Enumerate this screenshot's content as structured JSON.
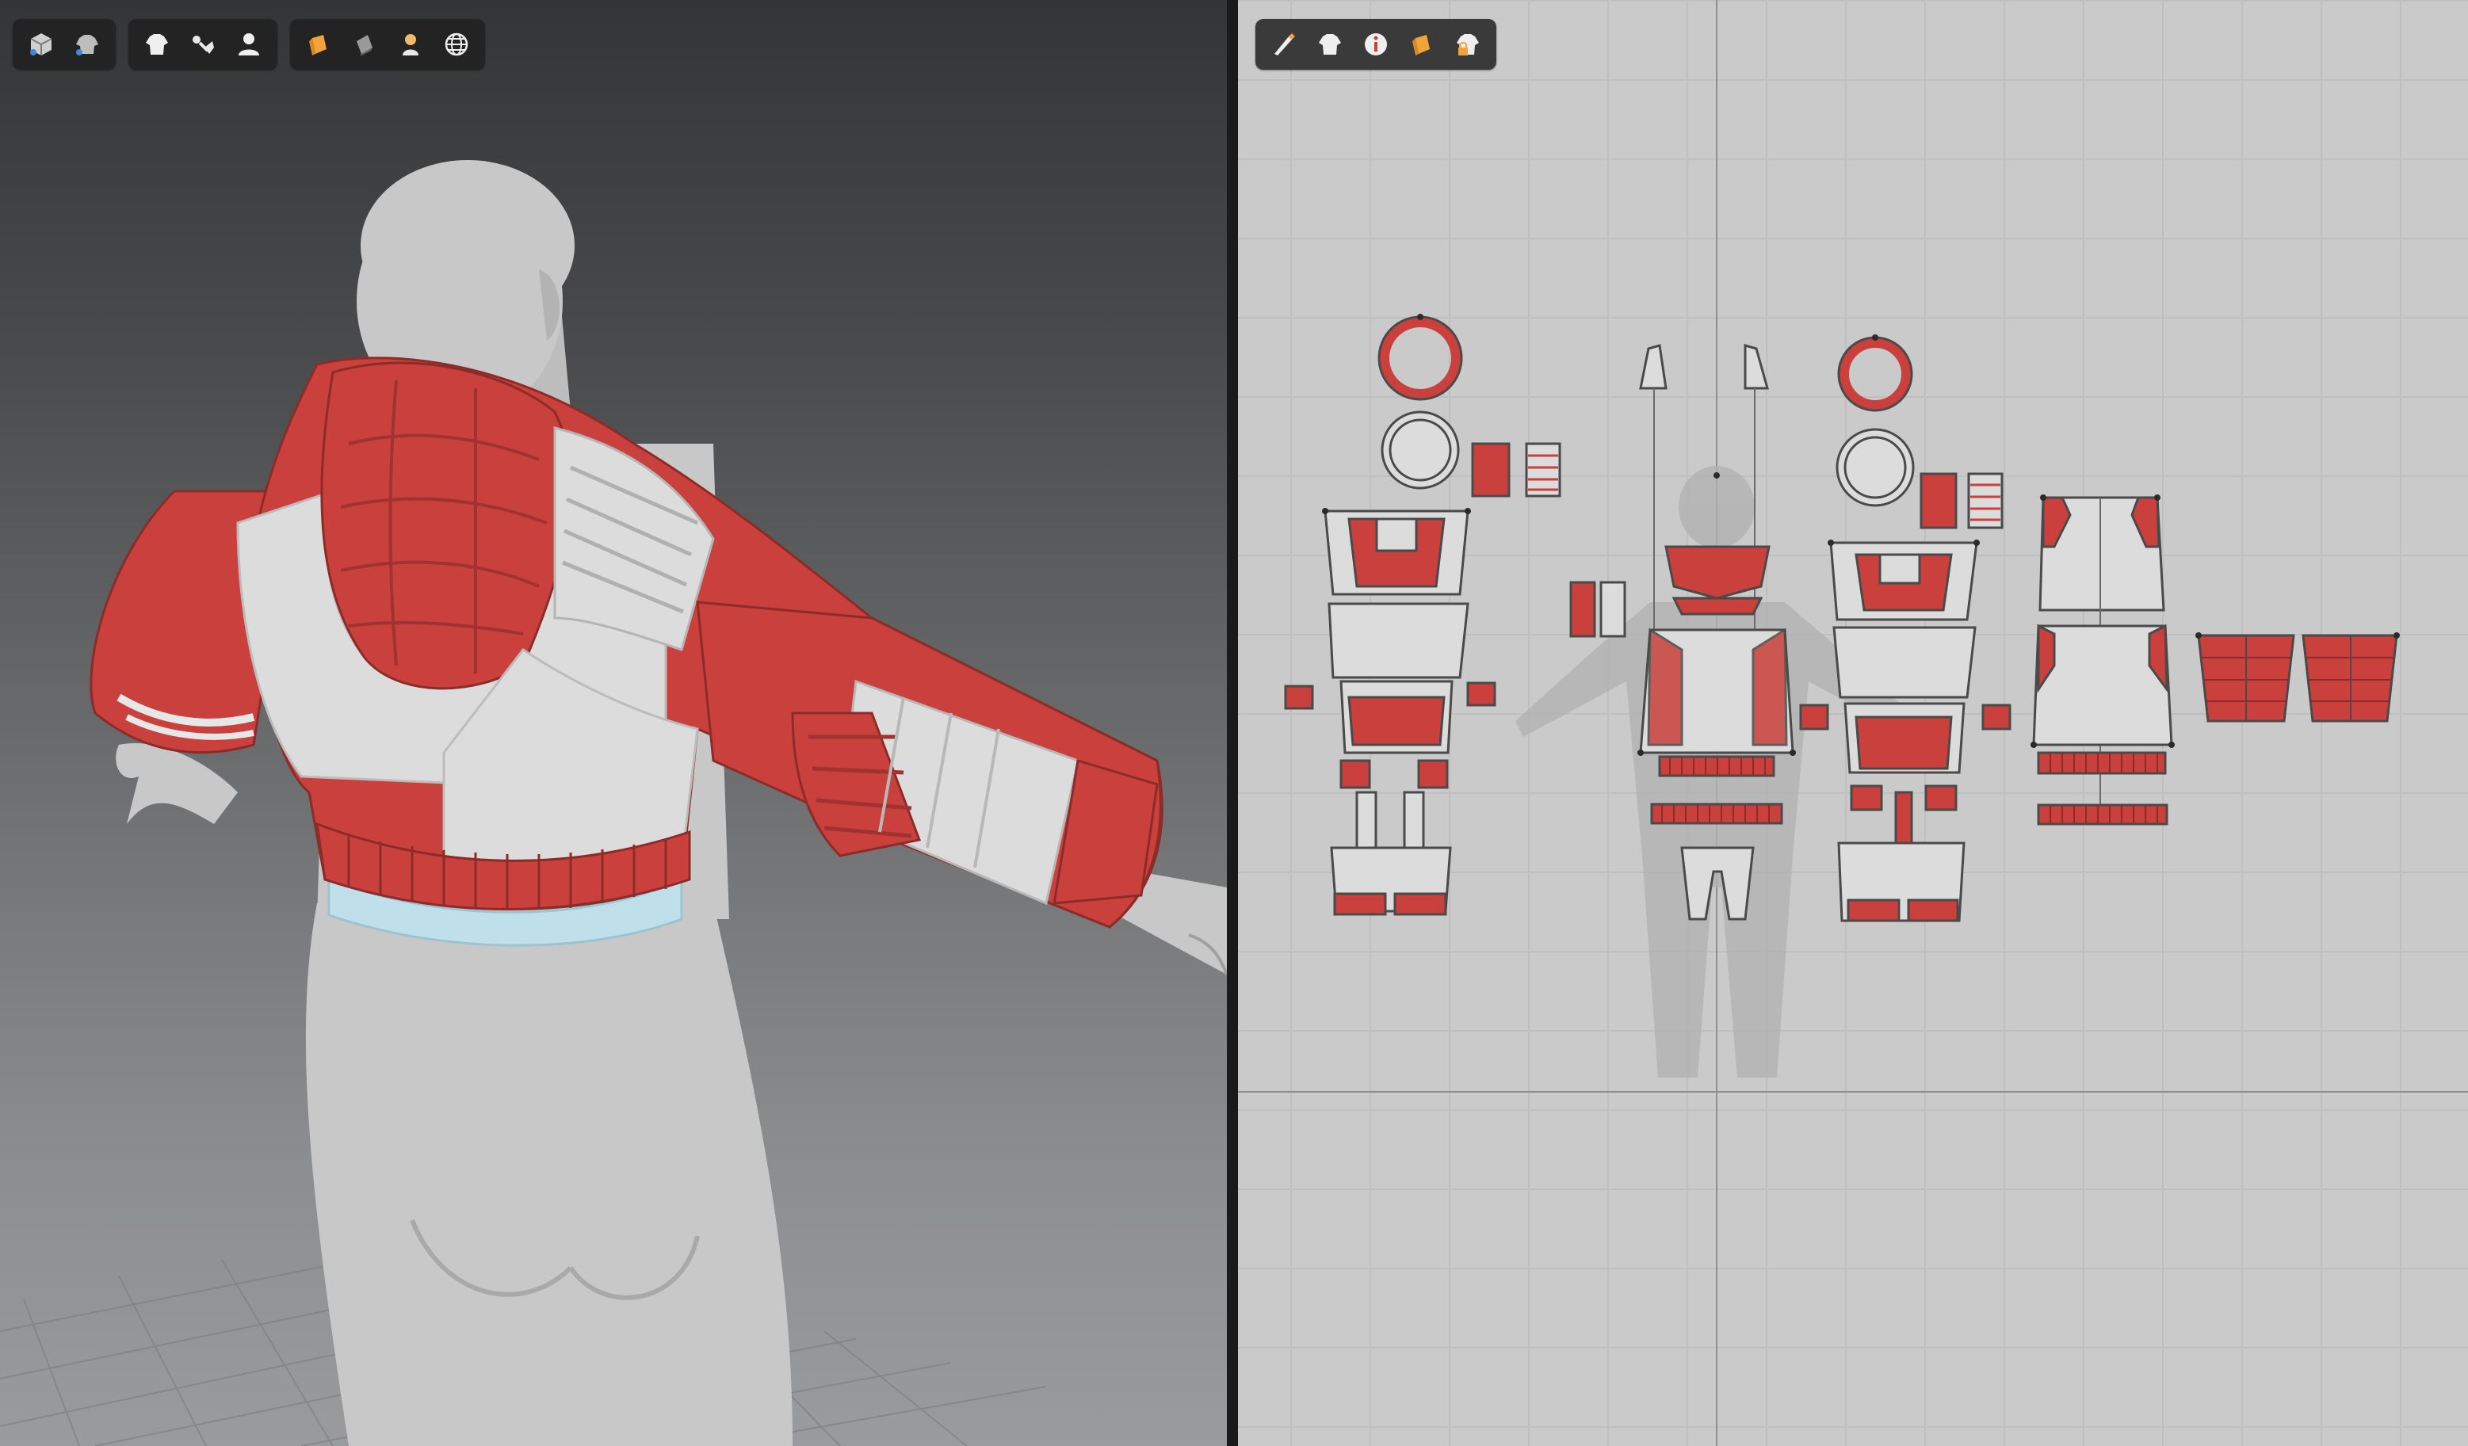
{
  "app": {
    "left_viewport": "3d-avatar-window",
    "right_viewport": "2d-pattern-window"
  },
  "colors": {
    "fabric_red": "#c9403c",
    "fabric_red_dark": "#a83532",
    "fabric_white": "#dcdcdc",
    "trim_blue": "#bfe0ea",
    "avatar_gray": "#c9c9c9",
    "grid_line": "#bfbfbf",
    "toolbar_bg": "#232323",
    "icon_light": "#e8e8e8",
    "icon_orange": "#f2a43a"
  },
  "toolbar_3d": {
    "groups": [
      [
        "cube-display-icon",
        "garment-display-icon"
      ],
      [
        "shirt-icon",
        "stitch-icon",
        "avatar-icon"
      ],
      [
        "texture-icon",
        "shading-icon",
        "avatar-surface-icon",
        "globe-icon"
      ]
    ]
  },
  "toolbar_2d": {
    "icons": [
      "pen-tool-icon",
      "shirt-icon",
      "info-icon",
      "texture-icon",
      "shirt-lock-icon"
    ]
  }
}
